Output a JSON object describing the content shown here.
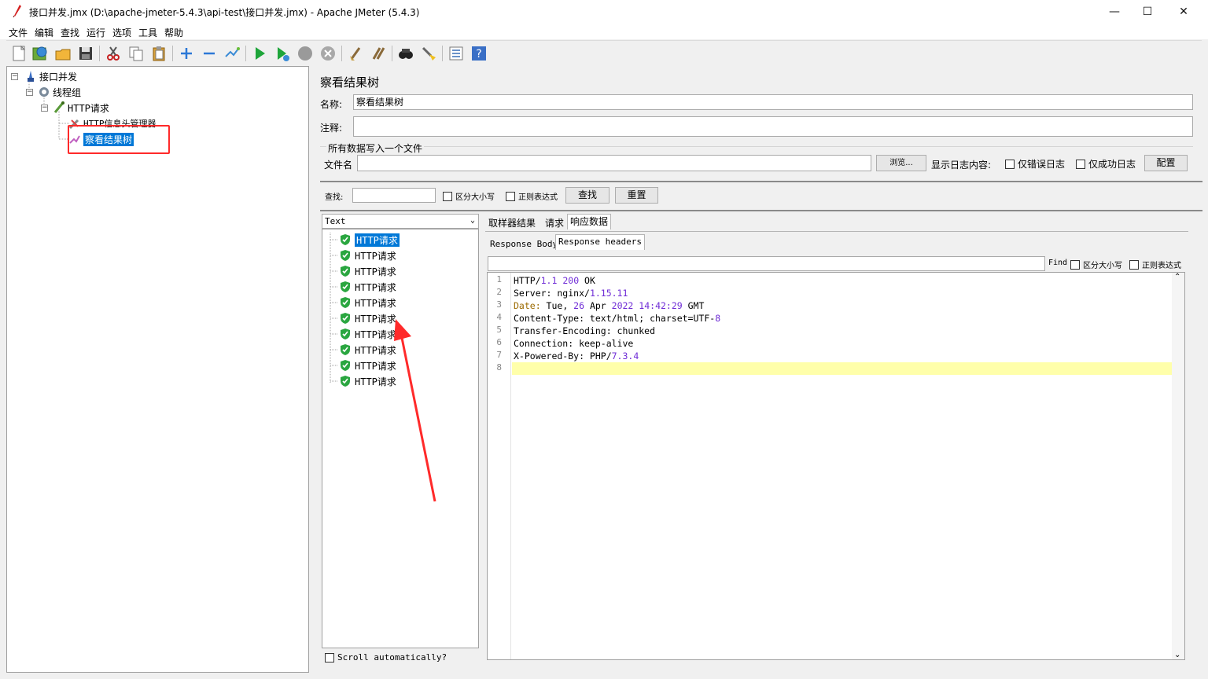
{
  "window": {
    "title": "接口并发.jmx (D:\\apache-jmeter-5.4.3\\api-test\\接口并发.jmx) - Apache JMeter (5.4.3)",
    "minimize": "—",
    "maximize": "☐",
    "close": "✕"
  },
  "menu": [
    "文件",
    "编辑",
    "查找",
    "运行",
    "选项",
    "工具",
    "帮助"
  ],
  "toolbar_icons": [
    "new-icon",
    "templates-icon",
    "open-icon",
    "save-icon",
    "cut-icon",
    "copy-icon",
    "paste-icon",
    "expand-icon",
    "collapse-icon",
    "toggle-icon",
    "start-icon",
    "start-no-pause-icon",
    "stop-icon",
    "shutdown-icon",
    "clear-icon",
    "clear-all-icon",
    "search-icon",
    "reset-search-icon",
    "function-helper-icon",
    "help-icon"
  ],
  "tree": {
    "root": "接口并发",
    "thread_group": "线程组",
    "http_request": "HTTP请求",
    "header_manager": "HTTP信息头管理器",
    "result_tree": "察看结果树"
  },
  "panel": {
    "title": "察看结果树",
    "name_label": "名称:",
    "name_value": "察看结果树",
    "comment_label": "注释:",
    "comment_value": "",
    "file_section": "所有数据写入一个文件",
    "file_label": "文件名",
    "file_value": "",
    "browse_button": "浏览...",
    "log_display_label": "显示日志内容:",
    "errors_only": "仅错误日志",
    "success_only": "仅成功日志",
    "configure_button": "配置"
  },
  "search": {
    "label": "查找:",
    "value": "",
    "case_sensitive": "区分大小写",
    "regex": "正则表达式",
    "find_button": "查找",
    "reset_button": "重置"
  },
  "renderer": {
    "selected": "Text"
  },
  "results": {
    "items": [
      "HTTP请求",
      "HTTP请求",
      "HTTP请求",
      "HTTP请求",
      "HTTP请求",
      "HTTP请求",
      "HTTP请求",
      "HTTP请求",
      "HTTP请求",
      "HTTP请求"
    ],
    "scroll_auto": "Scroll automatically?"
  },
  "result_tabs": [
    "取样器结果",
    "请求",
    "响应数据"
  ],
  "response_tabs": [
    "Response Body",
    "Response headers"
  ],
  "find_bar": {
    "find_label": "Find",
    "case_sensitive": "区分大小写",
    "regex": "正则表达式"
  },
  "response_lines": [
    {
      "n": "1",
      "parts": [
        {
          "t": "HTTP/",
          "c": ""
        },
        {
          "t": "1.1",
          "c": "num"
        },
        {
          "t": " ",
          "c": ""
        },
        {
          "t": "200",
          "c": "num"
        },
        {
          "t": " OK",
          "c": ""
        }
      ]
    },
    {
      "n": "2",
      "parts": [
        {
          "t": "Server: nginx/",
          "c": ""
        },
        {
          "t": "1.15.11",
          "c": "num"
        }
      ]
    },
    {
      "n": "3",
      "parts": [
        {
          "t": "Date:",
          "c": "key"
        },
        {
          "t": " Tue, ",
          "c": ""
        },
        {
          "t": "26",
          "c": "num"
        },
        {
          "t": " Apr ",
          "c": ""
        },
        {
          "t": "2022",
          "c": "num"
        },
        {
          "t": " ",
          "c": ""
        },
        {
          "t": "14:42:29",
          "c": "num"
        },
        {
          "t": " GMT",
          "c": ""
        }
      ]
    },
    {
      "n": "4",
      "parts": [
        {
          "t": "Content-Type: text/html; charset=UTF-",
          "c": ""
        },
        {
          "t": "8",
          "c": "num"
        }
      ]
    },
    {
      "n": "5",
      "parts": [
        {
          "t": "Transfer-Encoding: chunked",
          "c": ""
        }
      ]
    },
    {
      "n": "6",
      "parts": [
        {
          "t": "Connection: keep-alive",
          "c": ""
        }
      ]
    },
    {
      "n": "7",
      "parts": [
        {
          "t": "X-Powered-By: PHP/",
          "c": ""
        },
        {
          "t": "7.3.4",
          "c": "num"
        }
      ]
    },
    {
      "n": "8",
      "parts": []
    }
  ],
  "colors": {
    "selection": "#0078d7",
    "annotation": "#ff2a2a",
    "current_line": "#ffffaa",
    "number": "#6f2cd6"
  }
}
